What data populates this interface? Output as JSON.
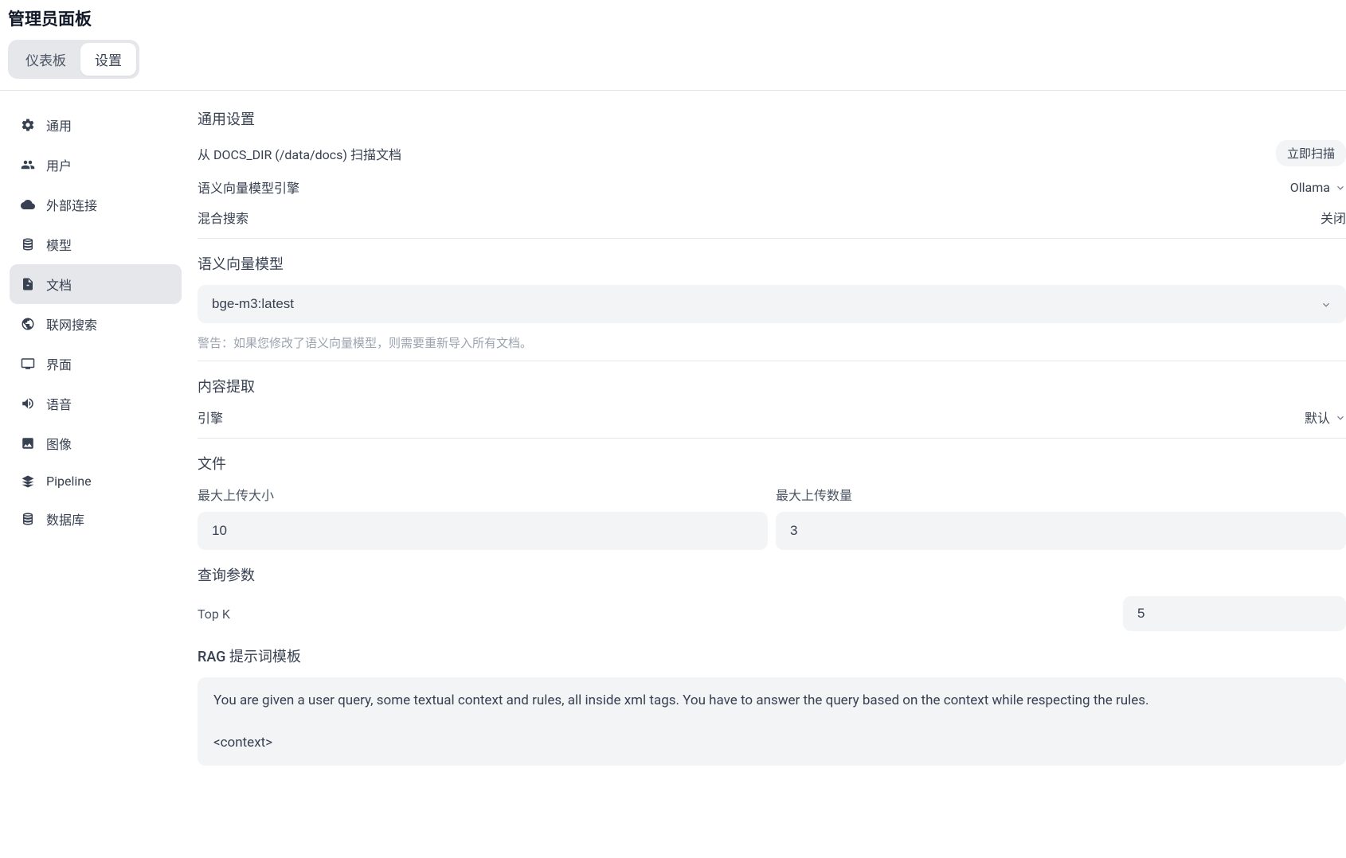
{
  "header": {
    "title": "管理员面板",
    "tabs": [
      {
        "label": "仪表板",
        "active": false
      },
      {
        "label": "设置",
        "active": true
      }
    ]
  },
  "sidebar": {
    "items": [
      {
        "id": "general",
        "label": "通用",
        "icon": "gear-icon"
      },
      {
        "id": "users",
        "label": "用户",
        "icon": "users-icon"
      },
      {
        "id": "external",
        "label": "外部连接",
        "icon": "cloud-icon"
      },
      {
        "id": "models",
        "label": "模型",
        "icon": "stack-icon"
      },
      {
        "id": "documents",
        "label": "文档",
        "icon": "file-icon"
      },
      {
        "id": "websearch",
        "label": "联网搜索",
        "icon": "globe-icon"
      },
      {
        "id": "interface",
        "label": "界面",
        "icon": "monitor-icon"
      },
      {
        "id": "audio",
        "label": "语音",
        "icon": "speaker-icon"
      },
      {
        "id": "images",
        "label": "图像",
        "icon": "image-icon"
      },
      {
        "id": "pipeline",
        "label": "Pipeline",
        "icon": "layers-icon"
      },
      {
        "id": "database",
        "label": "数据库",
        "icon": "database-icon"
      }
    ],
    "selected": "documents"
  },
  "content": {
    "general_settings": {
      "title": "通用设置",
      "scan_label": "从 DOCS_DIR (/data/docs) 扫描文档",
      "scan_button": "立即扫描",
      "embedding_engine_label": "语义向量模型引擎",
      "embedding_engine_value": "Ollama",
      "hybrid_search_label": "混合搜索",
      "hybrid_search_value": "关闭"
    },
    "embedding_model": {
      "title": "语义向量模型",
      "value": "bge-m3:latest",
      "warning": "警告：如果您修改了语义向量模型，则需要重新导入所有文档。"
    },
    "content_extraction": {
      "title": "内容提取",
      "engine_label": "引擎",
      "engine_value": "默认"
    },
    "files": {
      "title": "文件",
      "max_size_label": "最大上传大小",
      "max_size_value": "10",
      "max_count_label": "最大上传数量",
      "max_count_value": "3"
    },
    "query_params": {
      "title": "查询参数",
      "topk_label": "Top K",
      "topk_value": "5"
    },
    "rag_template": {
      "title": "RAG 提示词模板",
      "value": "You are given a user query, some textual context and rules, all inside xml tags. You have to answer the query based on the context while respecting the rules.\n\n<context>"
    }
  }
}
